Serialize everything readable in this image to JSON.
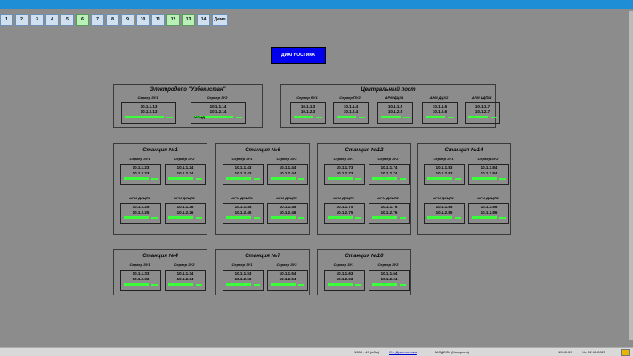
{
  "tabs": [
    "1",
    "2",
    "3",
    "4",
    "5",
    "6",
    "7",
    "8",
    "9",
    "10",
    "11",
    "12",
    "13",
    "14",
    "Демо"
  ],
  "diag_button": "ДИАГНОСТИКА",
  "elektrodepo": {
    "title": "Электродепо     \"Узбекистан\"",
    "servers": [
      {
        "label": "Сервер ЗУ1",
        "ip1": "10.1.1.13",
        "ip2": "10.1.2.13"
      },
      {
        "label": "Сервер ЗУ2",
        "ip1": "10.1.1.14",
        "ip2": "10.1.2.14"
      }
    ],
    "mpcd": "МПЦД"
  },
  "central": {
    "title": "Центральный пост",
    "servers": [
      {
        "label": "Сервер ПУ1",
        "ip1": "10.1.1.3",
        "ip2": "10.1.2.3"
      },
      {
        "label": "Сервер ПУ2",
        "ip1": "10.1.1.4",
        "ip2": "10.1.2.4"
      },
      {
        "label": "АРМ ДЦХ1",
        "ip1": "10.1.1.5",
        "ip2": "10.1.2.5"
      },
      {
        "label": "АРМ ДЦХ2",
        "ip1": "10.1.1.6",
        "ip2": "10.1.2.6"
      },
      {
        "label": "АРМ ЦДПШ",
        "ip1": "10.1.1.7",
        "ip2": "10.1.2.7"
      }
    ]
  },
  "stations": [
    {
      "title": "Станция №1",
      "boxes": [
        {
          "label": "Сервер ЗУ1",
          "ip1": "10.1.1.23",
          "ip2": "10.1.2.23"
        },
        {
          "label": "Сервер ЗУ2",
          "ip1": "10.1.1.24",
          "ip2": "10.1.2.24"
        },
        {
          "label": "АРМ ДСЦП1",
          "ip1": "10.1.1.25",
          "ip2": "10.1.2.25"
        },
        {
          "label": "АРМ ДСЦП2",
          "ip1": "10.1.1.26",
          "ip2": "10.1.2.26"
        }
      ]
    },
    {
      "title": "Станция №6",
      "boxes": [
        {
          "label": "Сервер ЗУ1",
          "ip1": "10.1.1.43",
          "ip2": "10.1.2.43"
        },
        {
          "label": "Сервер ЗУ2",
          "ip1": "10.1.1.44",
          "ip2": "10.1.2.44"
        },
        {
          "label": "АРМ ДСЦП1",
          "ip1": "10.1.1.45",
          "ip2": "10.1.2.45"
        },
        {
          "label": "АРМ ДСЦП2",
          "ip1": "10.1.1.46",
          "ip2": "10.1.2.46"
        }
      ]
    },
    {
      "title": "Станция №12",
      "boxes": [
        {
          "label": "Сервер ЗУ1",
          "ip1": "10.1.1.73",
          "ip2": "10.1.2.73"
        },
        {
          "label": "Сервер ЗУ2",
          "ip1": "10.1.1.74",
          "ip2": "10.1.2.74"
        },
        {
          "label": "АРМ ДСЦП1",
          "ip1": "10.1.1.75",
          "ip2": "10.1.2.75"
        },
        {
          "label": "АРМ ДСЦП2",
          "ip1": "10.1.1.76",
          "ip2": "10.1.2.76"
        }
      ]
    },
    {
      "title": "Станция №14",
      "boxes": [
        {
          "label": "Сервер ЗУ1",
          "ip1": "10.1.1.83",
          "ip2": "10.1.2.83"
        },
        {
          "label": "Сервер ЗУ2",
          "ip1": "10.1.1.84",
          "ip2": "10.1.2.84"
        },
        {
          "label": "АРМ ДСЦП1",
          "ip1": "10.1.1.85",
          "ip2": "10.1.2.85"
        },
        {
          "label": "АРМ ДСЦП2",
          "ip1": "10.1.1.86",
          "ip2": "10.1.2.86"
        }
      ]
    },
    {
      "title": "Станция №4",
      "boxes": [
        {
          "label": "Сервер ЗУ1",
          "ip1": "10.1.1.33",
          "ip2": "10.1.2.33"
        },
        {
          "label": "Сервер ЗУ2",
          "ip1": "10.1.1.34",
          "ip2": "10.1.2.34"
        }
      ]
    },
    {
      "title": "Станция №7",
      "boxes": [
        {
          "label": "Сервер ЗУ1",
          "ip1": "10.1.1.53",
          "ip2": "10.1.2.53"
        },
        {
          "label": "Сервер ЗУ2",
          "ip1": "10.1.1.54",
          "ip2": "10.1.2.54"
        }
      ]
    },
    {
      "title": "Станция №10",
      "boxes": [
        {
          "label": "Сервер ЗУ1",
          "ip1": "10.1.1.63",
          "ip2": "10.1.2.63"
        },
        {
          "label": "Сервер ЗУ2",
          "ip1": "10.1.1.64",
          "ip2": "10.1.2.64"
        }
      ]
    }
  ],
  "status": {
    "count": "1308 : 49 (обш)",
    "link": "С.т. Диагностика",
    "model": "МОДЕЛЬ (Контроль)",
    "time": "13:30:59",
    "date": "Чт. 02.11.2023"
  },
  "colors": {
    "background": "#8c8c8c",
    "status_ok": "#3cff3c",
    "accent": "#0000ee",
    "topbar": "#1e8fd6"
  }
}
